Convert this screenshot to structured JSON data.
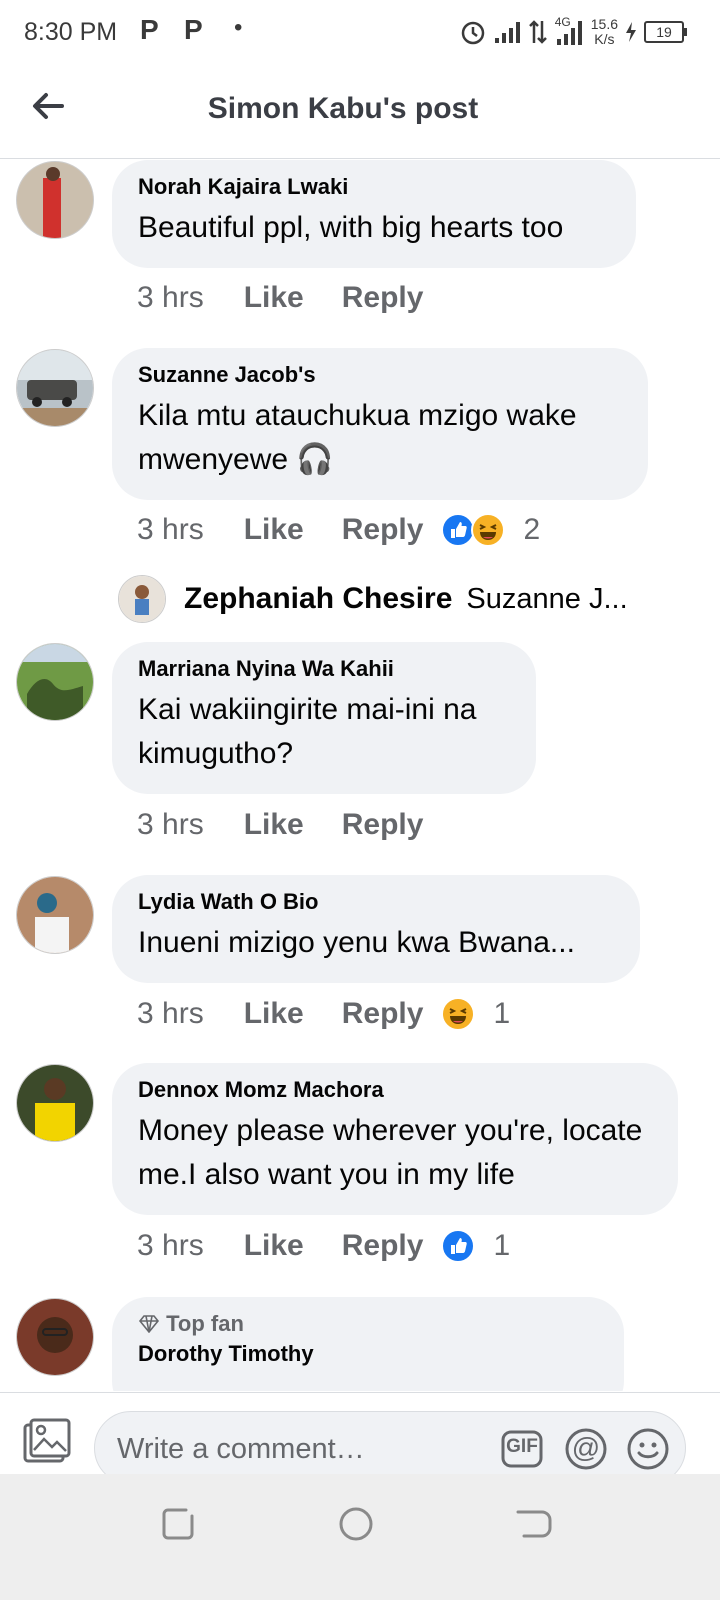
{
  "status_bar": {
    "time": "8:30 PM",
    "p1": "P",
    "p2": "P",
    "dot": "•",
    "net_type": "4G",
    "speed_value": "15.6",
    "speed_unit": "K/s",
    "battery": "19"
  },
  "header": {
    "title": "Simon Kabu's post",
    "back_icon": "back-arrow-icon"
  },
  "comments": [
    {
      "name": "Norah Kajaira Lwaki",
      "text": "Beautiful ppl, with big hearts too",
      "time": "3 hrs",
      "like": "Like",
      "reply": "Reply"
    },
    {
      "name": "Suzanne Jacob's",
      "text": "Kila mtu atauchukua mzigo wake mwenyewe 🎧",
      "time": "3 hrs",
      "like": "Like",
      "reply": "Reply",
      "reaction_count": "2",
      "reactions": [
        "like",
        "haha"
      ]
    },
    {
      "name": "Marriana Nyina Wa Kahii",
      "text": "Kai wakiingirite mai-ini na kimugutho?",
      "time": "3 hrs",
      "like": "Like",
      "reply": "Reply"
    },
    {
      "name": "Lydia Wath O Bio",
      "text": "Inueni mizigo yenu kwa Bwana...",
      "time": "3 hrs",
      "like": "Like",
      "reply": "Reply",
      "reaction_count": "1",
      "reactions": [
        "haha"
      ]
    },
    {
      "name": "Dennox Momz Machora",
      "text": "Money please wherever you're, locate me.I also want you in my life",
      "time": "3 hrs",
      "like": "Like",
      "reply": "Reply",
      "reaction_count": "1",
      "reactions": [
        "like"
      ]
    },
    {
      "name": "Dorothy Timothy",
      "badge": "Top fan"
    }
  ],
  "reply_preview": {
    "name": "Zephaniah Chesire",
    "text": "Suzanne J..."
  },
  "composer": {
    "placeholder": "Write a comment…",
    "gif_label": "GIF",
    "mention_label": "@"
  },
  "colors": {
    "bubble": "#f0f2f5",
    "meta_text": "#65676b",
    "like_blue": "#1877f2",
    "haha_yellow": "#f7b125"
  }
}
